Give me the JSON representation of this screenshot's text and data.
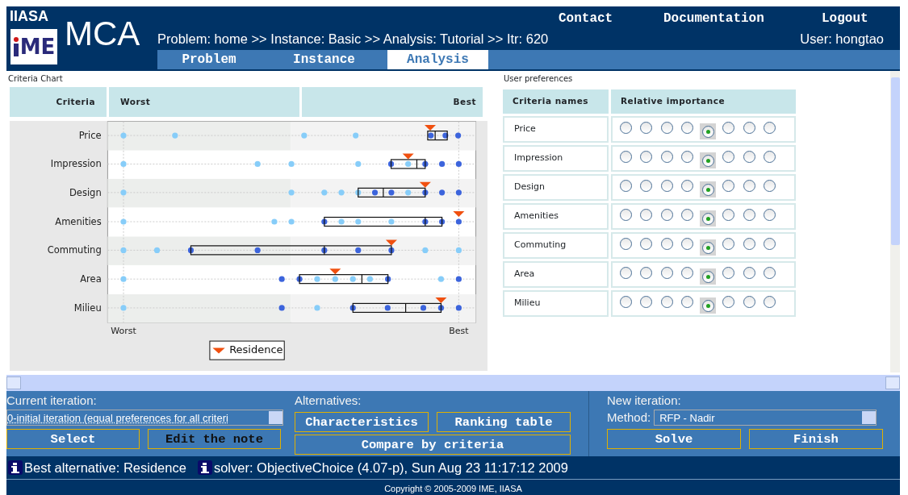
{
  "header": {
    "logo_top": "IIASA",
    "logo_mark": "ME",
    "app_name": "MCA",
    "breadcrumb": "Problem: home >> Instance: Basic >> Analysis: Tutorial >> Itr: 620",
    "user": "User: hongtao",
    "links": [
      "Contact",
      "Documentation",
      "Logout"
    ],
    "tabs": [
      {
        "label": "Problem",
        "selected": false
      },
      {
        "label": "Instance",
        "selected": false
      },
      {
        "label": "Analysis",
        "selected": true
      }
    ]
  },
  "criteria_chart": {
    "title": "Criteria Chart",
    "columns": [
      "Criteria",
      "Worst",
      "Best"
    ],
    "criteria": [
      "Price",
      "Impression",
      "Design",
      "Amenities",
      "Commuting",
      "Area",
      "Milieu"
    ],
    "axis_labels": [
      "Worst",
      "Best"
    ],
    "legend": "Residence"
  },
  "preferences": {
    "title": "User preferences",
    "columns": [
      "Criteria names",
      "Relative importance"
    ],
    "rows": [
      {
        "name": "Price",
        "radios": [
          {
            "selected": false
          },
          {
            "selected": false
          },
          {
            "selected": false
          },
          {
            "selected": false
          },
          {
            "selected": true
          },
          {
            "selected": false
          },
          {
            "selected": false
          },
          {
            "selected": false
          }
        ]
      },
      {
        "name": "Impression",
        "radios": [
          {
            "selected": false
          },
          {
            "selected": false
          },
          {
            "selected": false
          },
          {
            "selected": false
          },
          {
            "selected": true
          },
          {
            "selected": false
          },
          {
            "selected": false
          },
          {
            "selected": false
          }
        ]
      },
      {
        "name": "Design",
        "radios": [
          {
            "selected": false
          },
          {
            "selected": false
          },
          {
            "selected": false
          },
          {
            "selected": false
          },
          {
            "selected": true
          },
          {
            "selected": false
          },
          {
            "selected": false
          },
          {
            "selected": false
          }
        ]
      },
      {
        "name": "Amenities",
        "radios": [
          {
            "selected": false
          },
          {
            "selected": false
          },
          {
            "selected": false
          },
          {
            "selected": false
          },
          {
            "selected": true
          },
          {
            "selected": false
          },
          {
            "selected": false
          },
          {
            "selected": false
          }
        ]
      },
      {
        "name": "Commuting",
        "radios": [
          {
            "selected": false
          },
          {
            "selected": false
          },
          {
            "selected": false
          },
          {
            "selected": false
          },
          {
            "selected": true
          },
          {
            "selected": false
          },
          {
            "selected": false
          },
          {
            "selected": false
          }
        ]
      },
      {
        "name": "Area",
        "radios": [
          {
            "selected": false
          },
          {
            "selected": false
          },
          {
            "selected": false
          },
          {
            "selected": false
          },
          {
            "selected": true
          },
          {
            "selected": false
          },
          {
            "selected": false
          },
          {
            "selected": false
          }
        ]
      },
      {
        "name": "Milieu",
        "radios": [
          {
            "selected": false
          },
          {
            "selected": false
          },
          {
            "selected": false
          },
          {
            "selected": false
          },
          {
            "selected": true
          },
          {
            "selected": false
          },
          {
            "selected": false
          },
          {
            "selected": false
          }
        ]
      }
    ]
  },
  "current_iteration": {
    "label": "Current iteration:",
    "value": "0-initial iteration (equal preferences for all criteri",
    "buttons": [
      "Select",
      "Edit the note"
    ]
  },
  "alternatives": {
    "label": "Alternatives:",
    "buttons": [
      "Characteristics",
      "Ranking table",
      "Compare by criteria"
    ]
  },
  "new_iteration": {
    "label": "New iteration:",
    "method_label": "Method:",
    "method": "RFP - Nadir",
    "buttons": [
      "Solve",
      "Finish"
    ]
  },
  "status": [
    "Best alternative: Residence",
    "solver: ObjectiveChoice (4.07-p), Sun Aug 23 11:17:12 2009"
  ],
  "copyright": "Copyright © 2005-2009 IME, IIASA"
}
